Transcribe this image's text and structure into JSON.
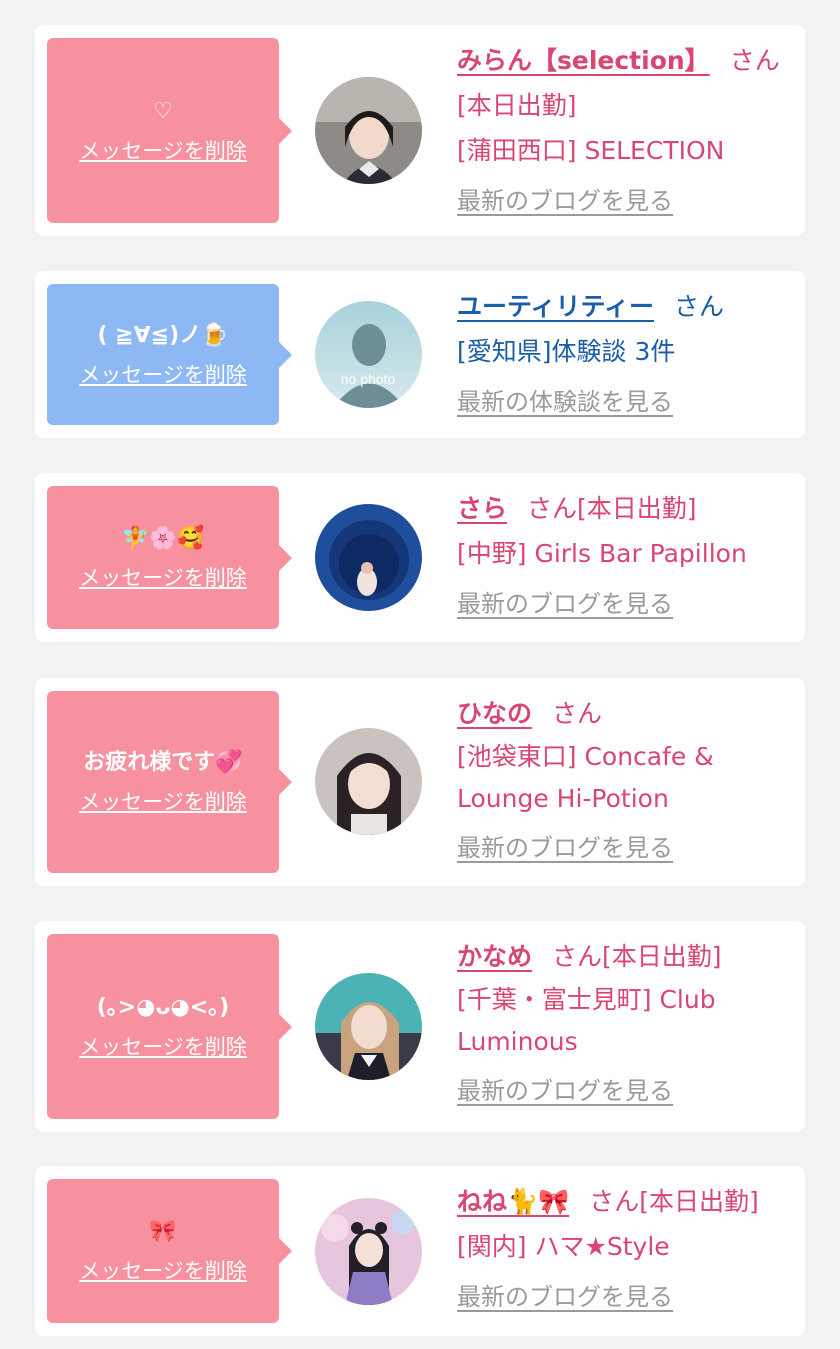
{
  "colors": {
    "pink_bubble": "#f8919f",
    "blue_bubble": "#8db8f4",
    "pink_text": "#d94670",
    "blue_text": "#1b5ea8",
    "link_gray": "#9a9a9a"
  },
  "entries": [
    {
      "message": "♡",
      "delete_label": "メッセージを削除",
      "name": "みらん【selection】",
      "suffix": "さん[本日出勤]",
      "shop": "[蒲田西口] SELECTION",
      "link": "最新のブログを見る",
      "avatar": "profile-photo"
    },
    {
      "message": "( ≧∀≦)ノ🍺",
      "delete_label": "メッセージを削除",
      "name": "ユーティリティー",
      "suffix": "さん",
      "shop": "[愛知県]体験談 3件",
      "link": "最新の体験談を見る",
      "avatar": "no-photo",
      "avatar_text": "no photo"
    },
    {
      "message": "🧚🌸🥰",
      "delete_label": "メッセージを削除",
      "name": "さら",
      "suffix": "さん[本日出勤]",
      "shop": "[中野] Girls Bar Papillon",
      "link": "最新のブログを見る",
      "avatar": "profile-photo"
    },
    {
      "message": "お疲れ様です💞",
      "delete_label": "メッセージを削除",
      "name": "ひなの",
      "suffix": "さん",
      "shop": "[池袋東口] Concafe & Lounge Hi-Potion",
      "link": "最新のブログを見る",
      "avatar": "profile-photo"
    },
    {
      "message": "(｡>◕ᴗ◕<｡)",
      "delete_label": "メッセージを削除",
      "name": "かなめ",
      "suffix": "さん[本日出勤]",
      "shop": "[千葉・富士見町] Club Luminous",
      "link": "最新のブログを見る",
      "avatar": "profile-photo"
    },
    {
      "message": "🎀",
      "delete_label": "メッセージを削除",
      "name": "ねね🐈🎀",
      "suffix": "さん[本日出勤]",
      "shop": "[関内] ハマ★Style",
      "link": "最新のブログを見る",
      "avatar": "profile-photo"
    }
  ]
}
